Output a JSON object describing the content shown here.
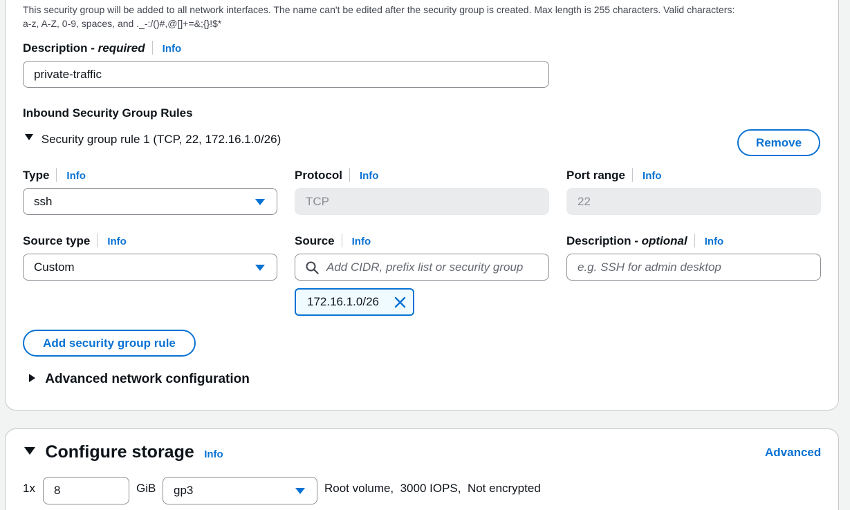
{
  "network": {
    "name_help": [
      "This security group will be added to all network interfaces. The name can't be edited after the security group is created. Max length is 255 characters. Valid characters:",
      "a-z, A-Z, 0-9, spaces, and ._-:/()#,@[]+=&;{}!$*"
    ],
    "description": {
      "label_main": "Description - ",
      "label_qualifier": "required",
      "info": "Info",
      "value": "private-traffic"
    },
    "inbound_rules_title": "Inbound Security Group Rules",
    "rule": {
      "title": "Security group rule 1 (TCP, 22, 172.16.1.0/26)",
      "remove_label": "Remove",
      "type": {
        "label": "Type",
        "info": "Info",
        "value": "ssh"
      },
      "protocol": {
        "label": "Protocol",
        "info": "Info",
        "value": "TCP"
      },
      "port_range": {
        "label": "Port range",
        "info": "Info",
        "value": "22"
      },
      "source_type": {
        "label": "Source type",
        "info": "Info",
        "value": "Custom"
      },
      "source": {
        "label": "Source",
        "info": "Info",
        "placeholder": "Add CIDR, prefix list or security group",
        "tokens": [
          "172.16.1.0/26"
        ]
      },
      "description": {
        "label_main": "Description - ",
        "label_qualifier": "optional",
        "info": "Info",
        "placeholder": "e.g. SSH for admin desktop"
      }
    },
    "add_rule_label": "Add security group rule",
    "advanced_network_label": "Advanced network configuration"
  },
  "storage": {
    "title": "Configure storage",
    "info": "Info",
    "advanced_link": "Advanced",
    "volume": {
      "count_prefix": "1x",
      "size": "8",
      "unit": "GiB",
      "volume_type": "gp3",
      "summary": "Root volume,  3000 IOPS,  Not encrypted"
    }
  },
  "colors": {
    "link": "#0972d3",
    "border": "#c6c6cd",
    "disabled_bg": "#e9ebed",
    "token_bg": "#f0fbff"
  },
  "icons": [
    "search-icon",
    "dismiss-icon",
    "caret-down-icon",
    "caret-right-icon"
  ]
}
